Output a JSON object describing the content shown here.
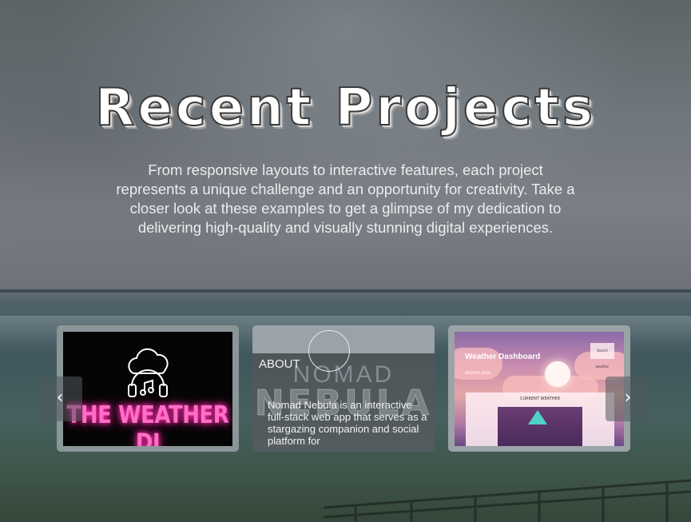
{
  "page": {
    "title": "Recent Projects",
    "intro": "From responsive layouts to interactive features, each project represents a unique challenge and an opportunity for creativity. Take a closer look at these examples to get a glimpse of my dedication to delivering high-quality and visually stunning digital experiences."
  },
  "carousel": {
    "prev_icon": "chevron-left-icon",
    "next_icon": "chevron-right-icon",
    "prev_glyph": "‹",
    "next_glyph": "›",
    "cards": [
      {
        "image_text": "THE WEATHER DJ",
        "icon": "cloud-headphones-icon"
      },
      {
        "heading": "ABOUT",
        "logo_top": "NOMAD",
        "logo_bottom": "NEBULA",
        "description": "Nomad Nebula is an interactive full-stack web app that serves as a stargazing companion and social platform for"
      },
      {
        "title": "Weather Dashboard",
        "subtitle": "WEATHER DASH",
        "button": "Search weather",
        "panel_title": "CURRENT WEATHER"
      }
    ]
  },
  "colors": {
    "neon_pink": "#ff6ec7",
    "text_light": "#ececec"
  }
}
